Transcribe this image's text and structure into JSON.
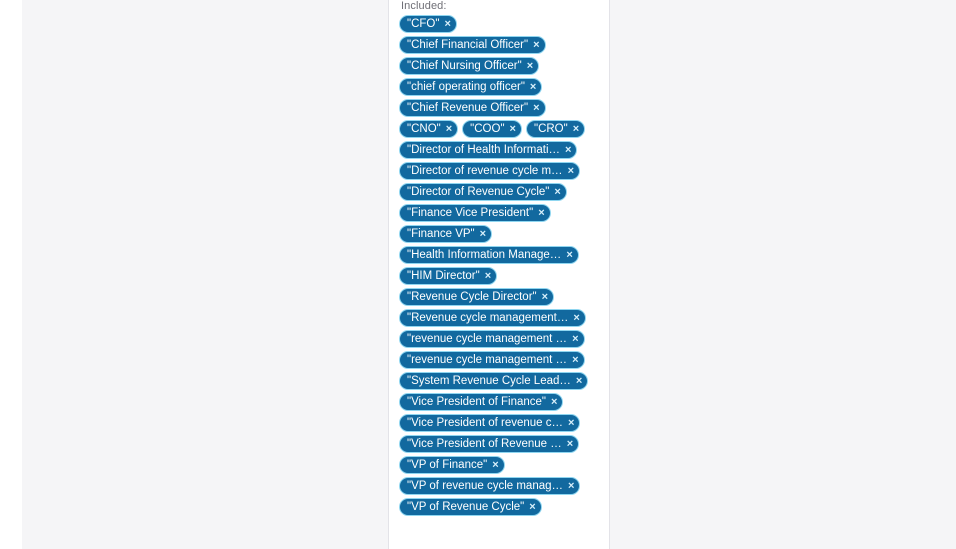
{
  "panel": {
    "section_label": "Included:",
    "remove_icon": "×",
    "accent_color": "#12699f",
    "accent_border_color": "#8fd6f0",
    "panel_background": "#ffffff",
    "app_background": "#f5f5f7"
  },
  "tags": [
    {
      "label": "\"CFO\""
    },
    {
      "label": "\"Chief Financial Officer\""
    },
    {
      "label": "\"Chief Nursing Officer\""
    },
    {
      "label": "\"chief operating officer\""
    },
    {
      "label": "\"Chief Revenue Officer\""
    },
    {
      "label": "\"CNO\""
    },
    {
      "label": "\"COO\""
    },
    {
      "label": "\"CRO\""
    },
    {
      "label": "\"Director of Health Informati…"
    },
    {
      "label": "\"Director of revenue cycle m…"
    },
    {
      "label": "\"Director of Revenue Cycle\""
    },
    {
      "label": "\"Finance Vice President\""
    },
    {
      "label": "\"Finance VP\""
    },
    {
      "label": "\"Health Information Manage…"
    },
    {
      "label": "\"HIM Director\""
    },
    {
      "label": "\"Revenue Cycle Director\""
    },
    {
      "label": "\"Revenue cycle management…"
    },
    {
      "label": "\"revenue cycle management …"
    },
    {
      "label": "\"revenue cycle management …"
    },
    {
      "label": "\"System Revenue Cycle Lead…"
    },
    {
      "label": "\"Vice President of Finance\""
    },
    {
      "label": "\"Vice President of revenue c…"
    },
    {
      "label": "\"Vice President of Revenue …"
    },
    {
      "label": "\"VP of Finance\""
    },
    {
      "label": "\"VP of revenue cycle manag…"
    },
    {
      "label": "\"VP of Revenue Cycle\""
    }
  ]
}
